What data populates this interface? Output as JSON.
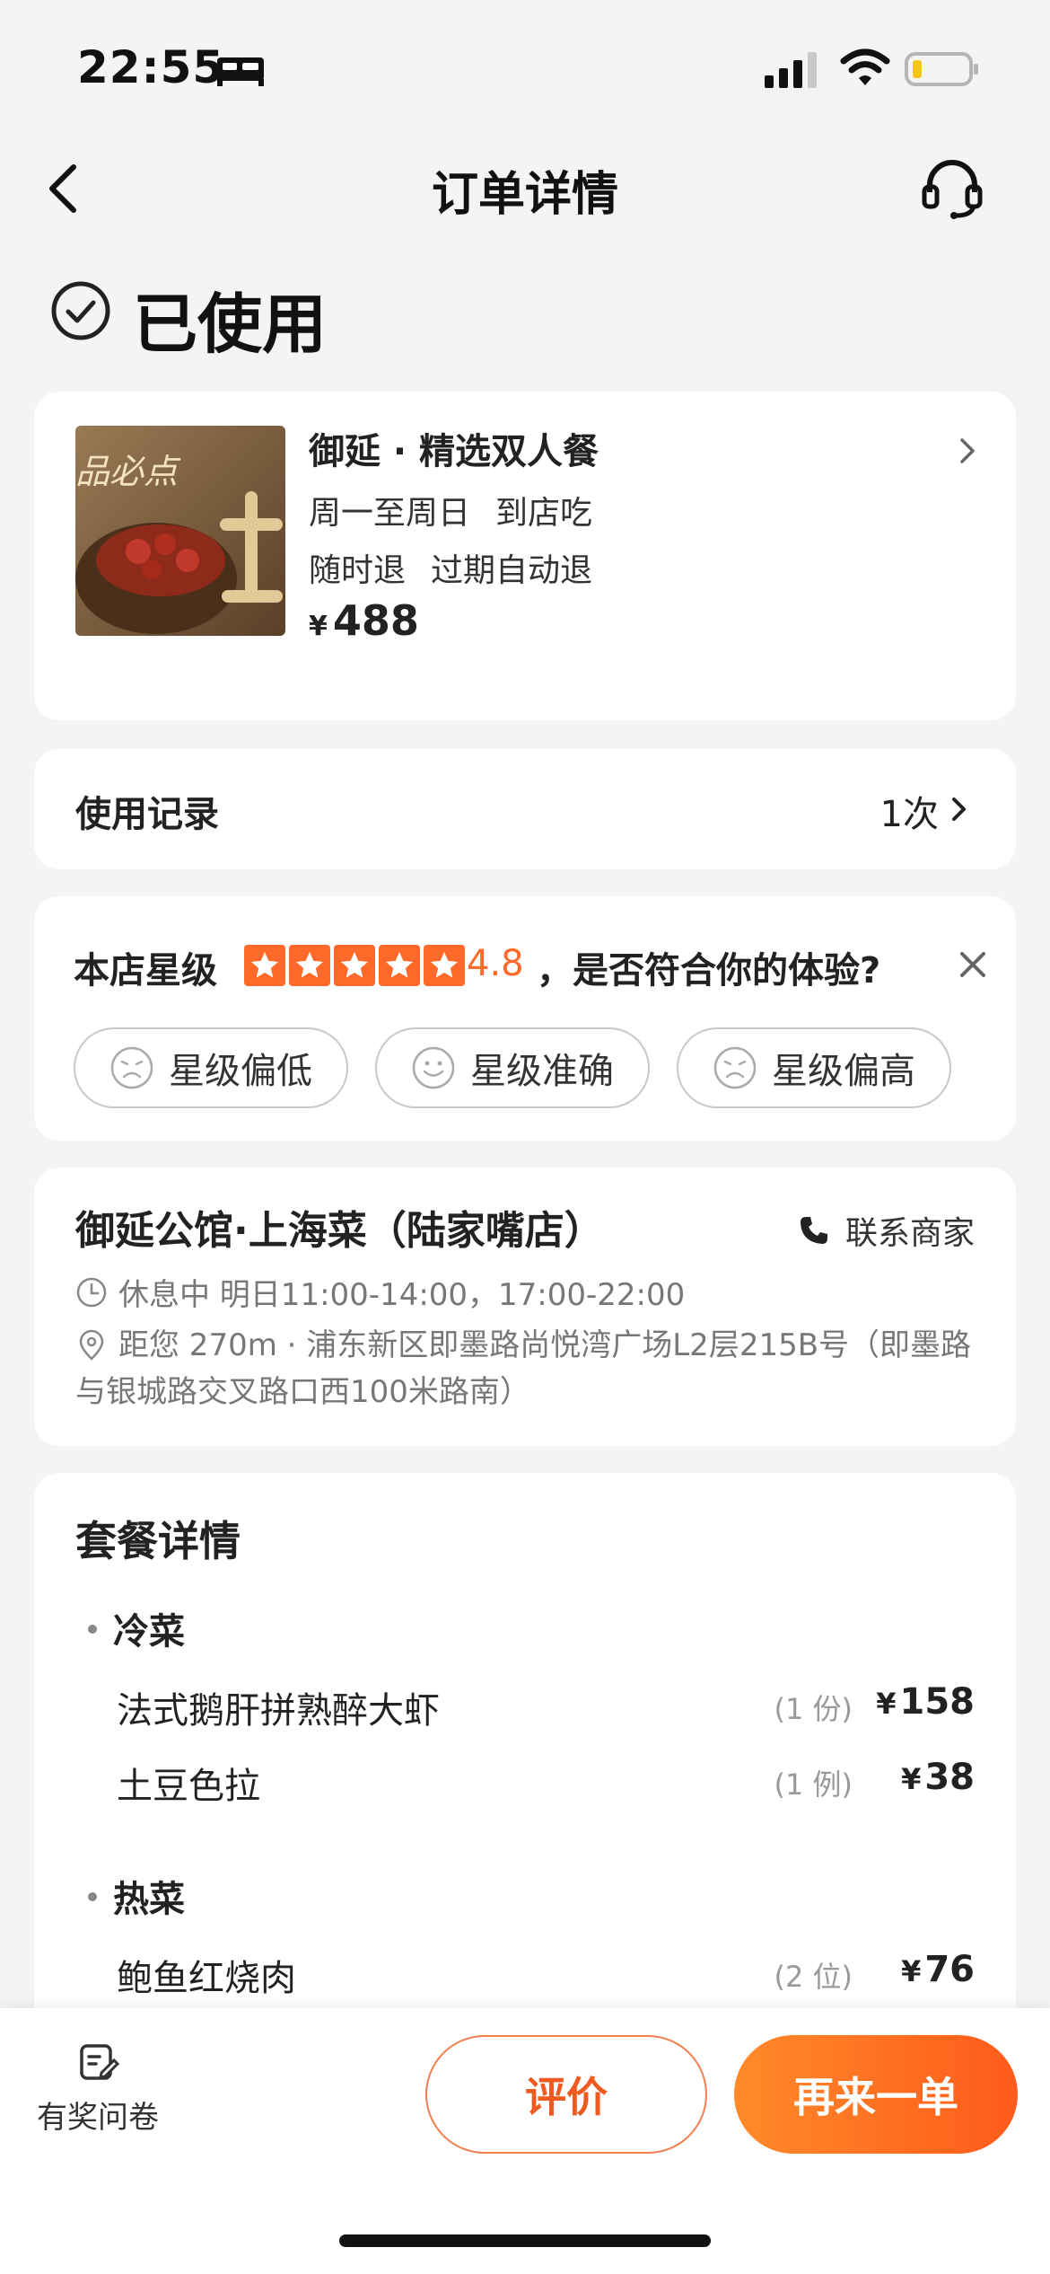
{
  "status_bar": {
    "time": "22:55"
  },
  "nav": {
    "title": "订单详情"
  },
  "order_status": {
    "text": "已使用"
  },
  "product": {
    "name": "御延 · 精选双人餐",
    "thumb_text": "品必点",
    "tags_line1": [
      "周一至周日",
      "到店吃"
    ],
    "tags_line2": [
      "随时退",
      "过期自动退"
    ],
    "currency": "¥",
    "price": "488"
  },
  "usage": {
    "label": "使用记录",
    "count": "1次"
  },
  "rating": {
    "label": "本店星级",
    "stars": 5,
    "score": "4.8",
    "question": "，是否符合你的体验?",
    "options": [
      "星级偏低",
      "星级准确",
      "星级偏高"
    ],
    "accent_color": "#ff6a2a"
  },
  "shop": {
    "name": "御延公馆·上海菜（陆家嘴店）",
    "contact_label": "联系商家",
    "hours": "休息中 明日11:00-14:00，17:00-22:00",
    "address": "距您 270m · 浦东新区即墨路尚悦湾广场L2层215B号（即墨路与银城路交叉路口西100米路南）"
  },
  "package": {
    "title": "套餐详情",
    "sections": [
      {
        "title": "冷菜",
        "items": [
          {
            "name": "法式鹅肝拼熟醉大虾",
            "qty": "(1 份)",
            "currency": "¥",
            "price": "158"
          },
          {
            "name": "土豆色拉",
            "qty": "(1 例)",
            "currency": "¥",
            "price": "38"
          }
        ]
      },
      {
        "title": "热菜",
        "items": [
          {
            "name": "鲍鱼红烧肉",
            "qty": "(2 位)",
            "currency": "¥",
            "price": "76"
          }
        ]
      }
    ]
  },
  "bottom_bar": {
    "survey_label": "有奖问卷",
    "review_label": "评价",
    "reorder_label": "再来一单"
  }
}
